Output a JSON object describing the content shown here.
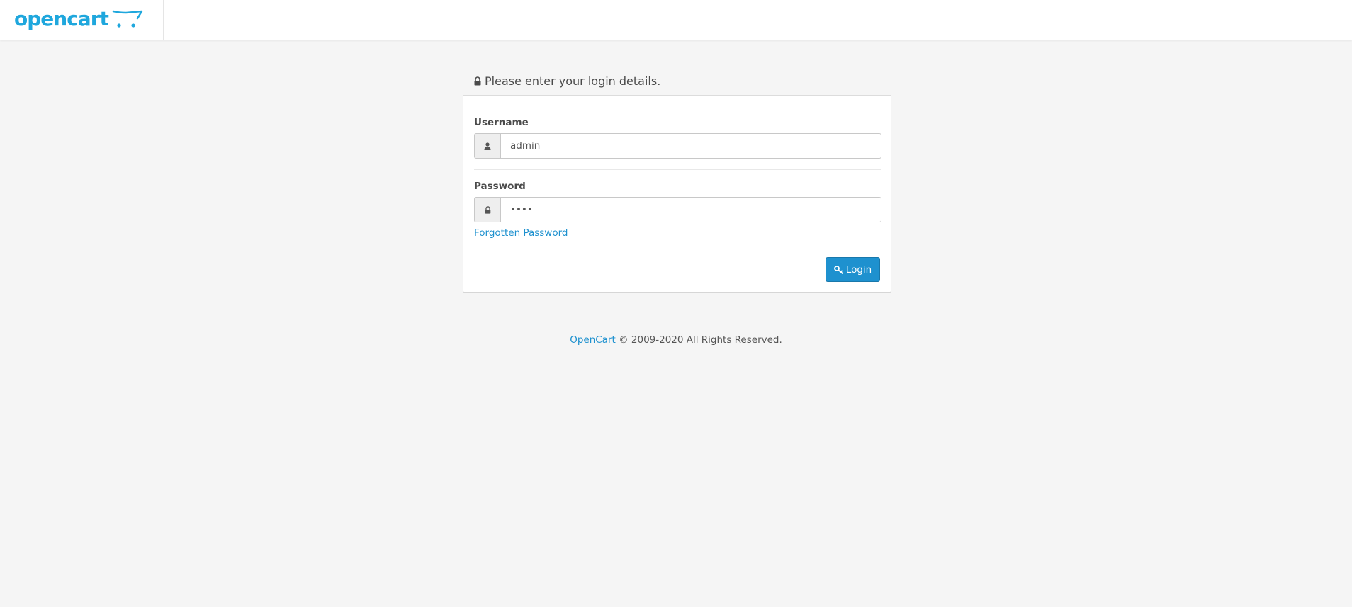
{
  "header": {
    "logo_text": "opencart"
  },
  "login_panel": {
    "heading": "Please enter your login details.",
    "username_label": "Username",
    "username_value": "admin",
    "password_label": "Password",
    "password_value": "demo",
    "forgot_link": "Forgotten Password",
    "login_button": "Login"
  },
  "footer": {
    "brand_link": "OpenCart",
    "copyright": "© 2009-2020 All Rights Reserved."
  },
  "colors": {
    "brand": "#1fa7dd",
    "accent": "#1e91cf",
    "background": "#f5f5f5"
  },
  "icons": {
    "heading": "lock-icon",
    "username": "user-icon",
    "password": "lock-icon",
    "login": "key-icon"
  }
}
